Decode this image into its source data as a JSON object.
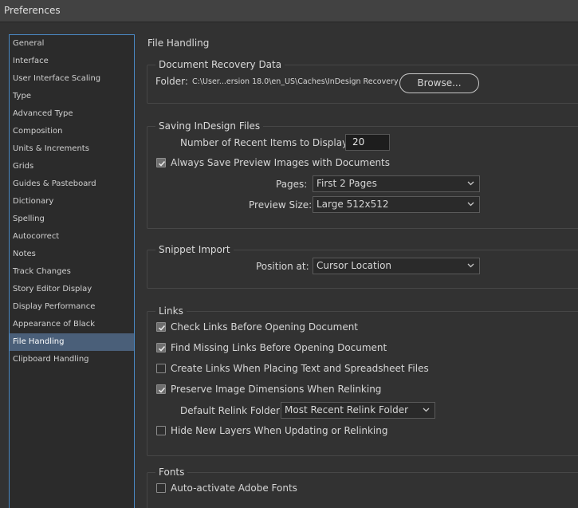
{
  "window": {
    "title": "Preferences"
  },
  "sidebar": {
    "items": [
      {
        "label": "General"
      },
      {
        "label": "Interface"
      },
      {
        "label": "User Interface Scaling"
      },
      {
        "label": "Type"
      },
      {
        "label": "Advanced Type"
      },
      {
        "label": "Composition"
      },
      {
        "label": "Units & Increments"
      },
      {
        "label": "Grids"
      },
      {
        "label": "Guides & Pasteboard"
      },
      {
        "label": "Dictionary"
      },
      {
        "label": "Spelling"
      },
      {
        "label": "Autocorrect"
      },
      {
        "label": "Notes"
      },
      {
        "label": "Track Changes"
      },
      {
        "label": "Story Editor Display"
      },
      {
        "label": "Display Performance"
      },
      {
        "label": "Appearance of Black"
      },
      {
        "label": "File Handling",
        "selected": true
      },
      {
        "label": "Clipboard Handling"
      }
    ]
  },
  "main": {
    "title": "File Handling",
    "document_recovery": {
      "legend": "Document Recovery Data",
      "folder_label": "Folder:",
      "folder_path": "C:\\User...ersion 18.0\\en_US\\Caches\\InDesign Recovery",
      "browse_label": "Browse..."
    },
    "saving": {
      "legend": "Saving InDesign Files",
      "recent_items_label": "Number of Recent Items to Display:",
      "recent_items_value": "20",
      "always_save_preview_label": "Always Save Preview Images with Documents",
      "always_save_preview_checked": true,
      "pages_label": "Pages:",
      "pages_value": "First 2 Pages",
      "preview_size_label": "Preview Size:",
      "preview_size_value": "Large 512x512"
    },
    "snippet_import": {
      "legend": "Snippet Import",
      "position_label": "Position at:",
      "position_value": "Cursor Location"
    },
    "links": {
      "legend": "Links",
      "check_links_label": "Check Links Before Opening Document",
      "check_links_checked": true,
      "find_missing_label": "Find Missing Links Before Opening Document",
      "find_missing_checked": true,
      "create_links_label": "Create Links When Placing Text and Spreadsheet Files",
      "create_links_checked": false,
      "preserve_dimensions_label": "Preserve Image Dimensions When Relinking",
      "preserve_dimensions_checked": true,
      "relink_folder_label": "Default Relink Folder:",
      "relink_folder_value": "Most Recent Relink Folder",
      "hide_layers_label": "Hide New Layers When Updating or Relinking",
      "hide_layers_checked": false
    },
    "fonts": {
      "legend": "Fonts",
      "auto_activate_label": "Auto-activate Adobe Fonts",
      "auto_activate_checked": false
    }
  },
  "icons": {
    "chevron": "chevron-down-icon",
    "checkmark": "checkmark-icon"
  },
  "colors": {
    "background": "#323232",
    "selection": "#4a5f79",
    "sidebar_border": "#4a89c4"
  }
}
